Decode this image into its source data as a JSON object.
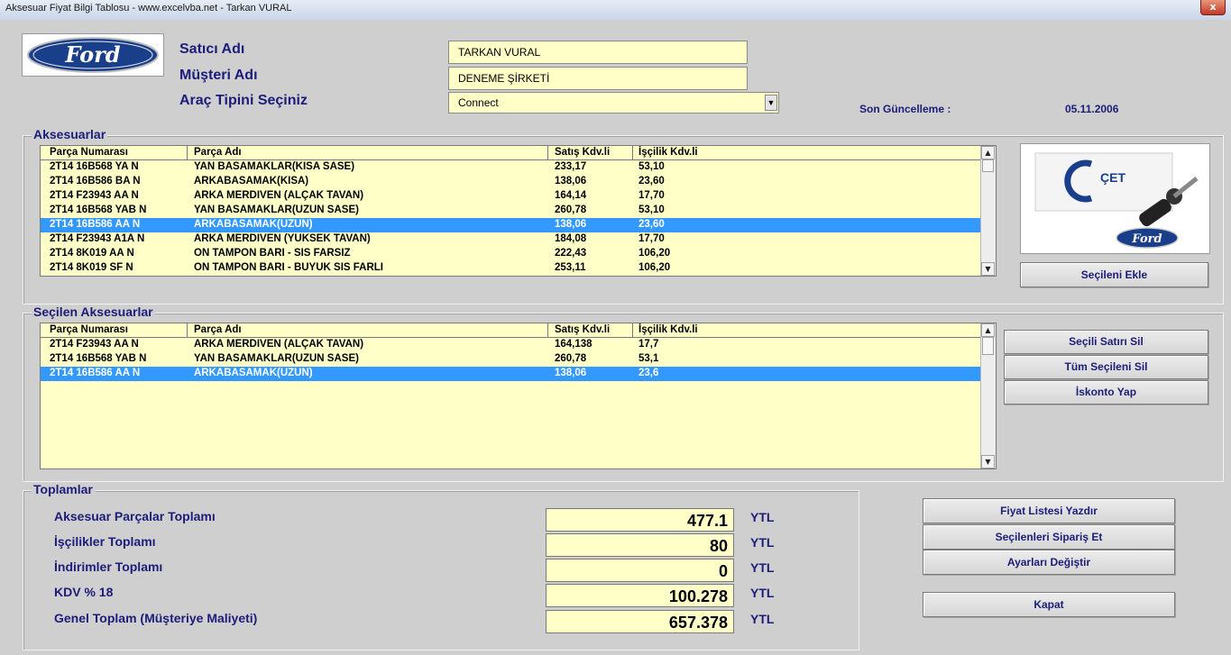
{
  "window": {
    "title": "Aksesuar Fiyat Bilgi Tablosu    - www.excelvba.net - Tarkan VURAL",
    "close_glyph": "x"
  },
  "header": {
    "logo_text": "Ford",
    "satici_label": "Satıcı Adı",
    "satici_value": "TARKAN VURAL",
    "musteri_label": "Müşteri Adı",
    "musteri_value": "DENEME ŞİRKETİ",
    "arac_label": "Araç Tipini Seçiniz",
    "arac_value": "Connect",
    "son_guncelleme_label": "Son Güncelleme :",
    "son_guncelleme_value": "05.11.2006"
  },
  "aksesuarlar": {
    "title": "Aksesuarlar",
    "columns": [
      "Parça Numarası",
      "Parça Adı",
      "Satış Kdv.li",
      "İşçilik Kdv.li"
    ],
    "rows": [
      [
        "2T14 16B568 YA N",
        "YAN BASAMAKLAR(KISA SASE)",
        "233,17",
        "53,10"
      ],
      [
        "2T14 16B586 BA N",
        "ARKABASAMAK(KISA)",
        "138,06",
        "23,60"
      ],
      [
        "2T14 F23943 AA N",
        "ARKA MERDIVEN (ALÇAK TAVAN)",
        "164,14",
        "17,70"
      ],
      [
        "2T14 16B568 YAB N",
        "YAN BASAMAKLAR(UZUN SASE)",
        "260,78",
        "53,10"
      ],
      [
        "2T14 16B586 AA N",
        "ARKABASAMAK(UZUN)",
        "138,06",
        "23,60"
      ],
      [
        "2T14 F23943 A1A N",
        "ARKA MERDIVEN (YUKSEK TAVAN)",
        "184,08",
        "17,70"
      ],
      [
        "2T14 8K019 AA N",
        "ON TAMPON BARI - SIS FARSIZ",
        "222,43",
        "106,20"
      ],
      [
        "2T14 8K019 SF N",
        "ON TAMPON BARI - BUYUK SIS FARLI",
        "253,11",
        "106,20"
      ]
    ],
    "selected_index": 4,
    "add_button": "Seçileni Ekle"
  },
  "brand_image": {
    "text1": "ÇET",
    "text2": "Ford"
  },
  "secilen": {
    "title": "Seçilen Aksesuarlar",
    "columns": [
      "Parça Numarası",
      "Parça Adı",
      "Satış Kdv.li",
      "İşçilik Kdv.li"
    ],
    "rows": [
      [
        "2T14 F23943 AA N",
        "ARKA MERDIVEN (ALÇAK TAVAN)",
        "164,138",
        "17,7"
      ],
      [
        "2T14 16B568 YAB N",
        "YAN BASAMAKLAR(UZUN SASE)",
        "260,78",
        "53,1"
      ],
      [
        "2T14 16B586 AA N",
        "ARKABASAMAK(UZUN)",
        "138,06",
        "23,6"
      ]
    ],
    "selected_index": 2,
    "buttons": {
      "delete_row": "Seçili Satırı Sil",
      "delete_all": "Tüm Seçileni Sil",
      "discount": "İskonto Yap"
    }
  },
  "toplamlar": {
    "title": "Toplamlar",
    "rows": [
      {
        "label": "Aksesuar Parçalar Toplamı",
        "value": "477.1",
        "unit": "YTL"
      },
      {
        "label": "İşçilikler Toplamı",
        "value": "80",
        "unit": "YTL"
      },
      {
        "label": "İndirimler Toplamı",
        "value": "0",
        "unit": "YTL"
      },
      {
        "label": "KDV % 18",
        "value": "100.278",
        "unit": "YTL"
      },
      {
        "label": "Genel Toplam (Müşteriye Maliyeti)",
        "value": "657.378",
        "unit": "YTL"
      }
    ]
  },
  "actions": {
    "print": "Fiyat Listesi Yazdır",
    "order": "Seçilenleri Sipariş Et",
    "settings": "Ayarları Değiştir",
    "close": "Kapat"
  },
  "icons": {
    "dropdown": "chevron-down-icon",
    "scroll_up": "arrow-up-icon",
    "scroll_down": "arrow-down-icon",
    "key": "key-icon"
  },
  "colors": {
    "label_blue": "#1c1c7a",
    "field_yellow": "#ffffc8",
    "selection_blue": "#3399ff"
  }
}
